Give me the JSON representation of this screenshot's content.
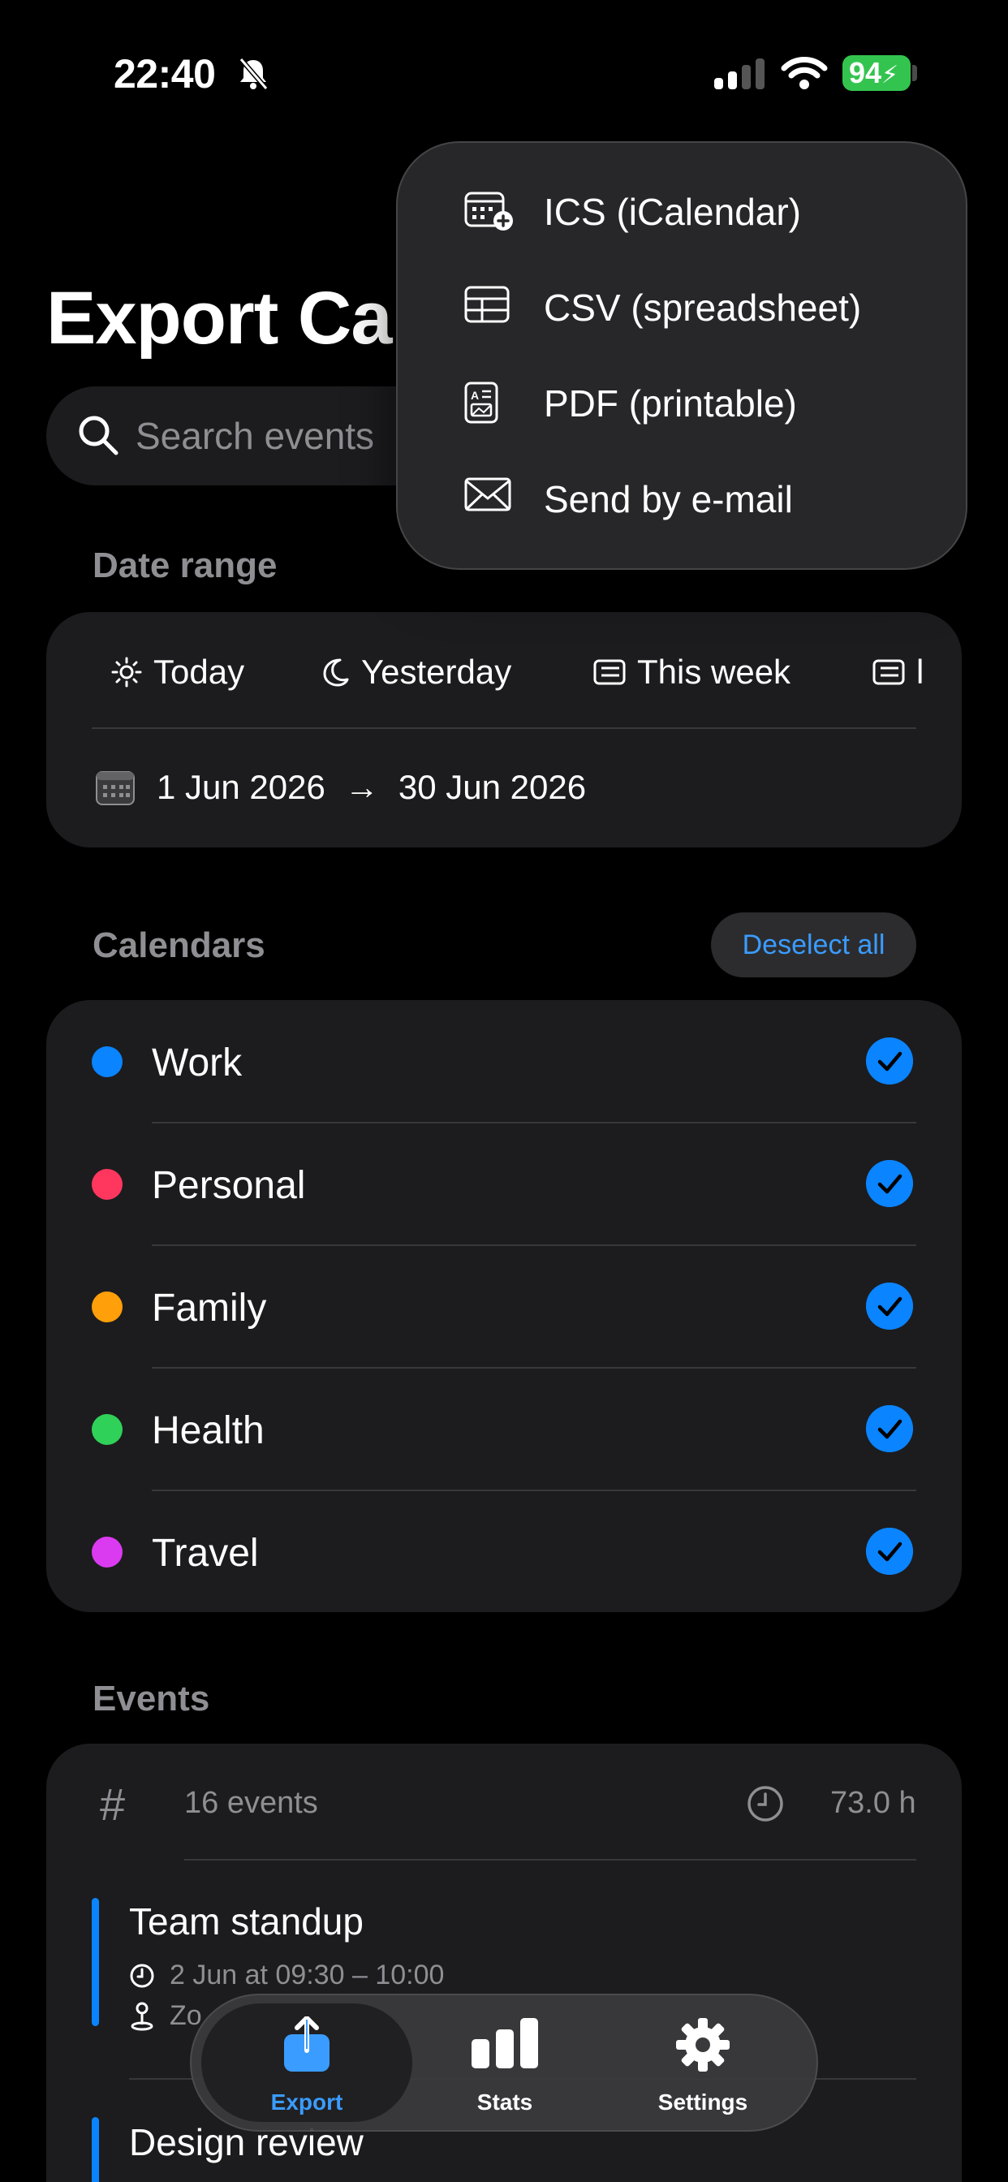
{
  "status": {
    "time": "22:40",
    "battery": "94"
  },
  "title": "Export Ca",
  "search": {
    "placeholder": "Search events"
  },
  "date_range": {
    "label": "Date range",
    "presets": [
      "Today",
      "Yesterday",
      "This week",
      "l"
    ],
    "range_start": "1 Jun 2026",
    "range_end": "30 Jun 2026"
  },
  "calendars": {
    "label": "Calendars",
    "deselect_label": "Deselect all",
    "items": [
      {
        "name": "Work",
        "color": "#0a84ff"
      },
      {
        "name": "Personal",
        "color": "#ff375f"
      },
      {
        "name": "Family",
        "color": "#ff9f0a"
      },
      {
        "name": "Health",
        "color": "#30d158"
      },
      {
        "name": "Travel",
        "color": "#da3bf0"
      }
    ]
  },
  "events": {
    "label": "Events",
    "count": "16 events",
    "total_hours": "73.0 h",
    "items": [
      {
        "title": "Team standup",
        "time": "2 Jun at 09:30 – 10:00",
        "location": "Zo"
      },
      {
        "title": "Design review"
      }
    ]
  },
  "menu": {
    "items": [
      {
        "label": "ICS (iCalendar)",
        "icon": "calendar-add-icon"
      },
      {
        "label": "CSV (spreadsheet)",
        "icon": "table-icon"
      },
      {
        "label": "PDF (printable)",
        "icon": "document-icon"
      },
      {
        "label": "Send by e-mail",
        "icon": "envelope-icon"
      }
    ]
  },
  "tabs": [
    {
      "label": "Export",
      "icon": "share-icon",
      "active": true
    },
    {
      "label": "Stats",
      "icon": "bar-chart-icon"
    },
    {
      "label": "Settings",
      "icon": "gear-icon"
    }
  ],
  "colors": {
    "accent": "#0a84ff",
    "card": "#1c1c1e",
    "secondary_text": "#8e8e93"
  }
}
